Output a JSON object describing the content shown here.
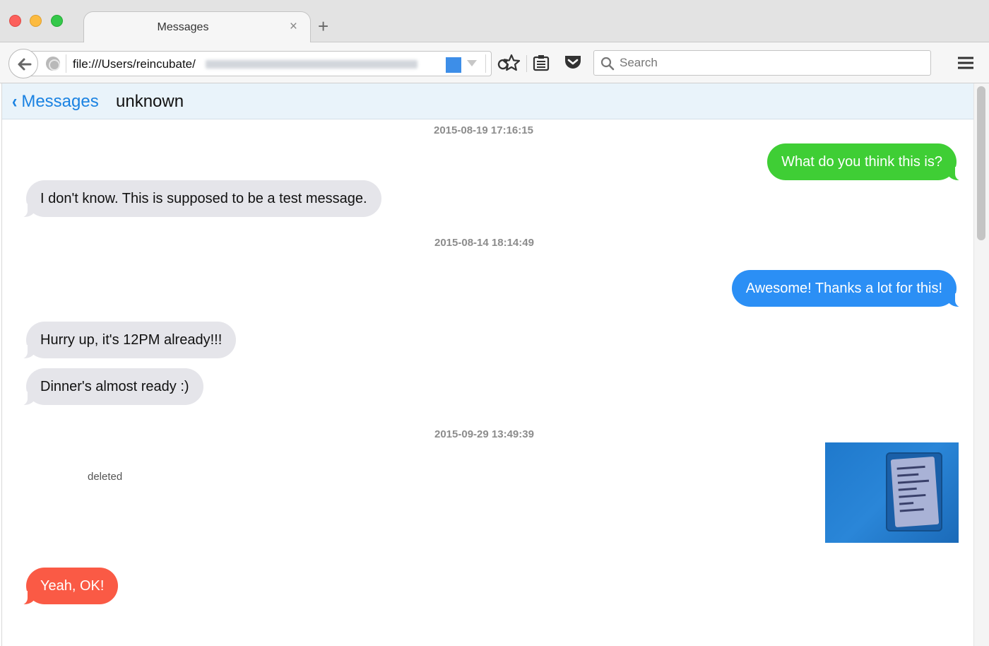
{
  "browser": {
    "tab_title": "Messages",
    "tab_close_icon": "×",
    "new_tab_icon": "+",
    "url": "file:///Users/reincubate/",
    "search_placeholder": "Search",
    "icons": [
      "back-arrow-icon",
      "globe-icon",
      "url-dropdown-icon",
      "reload-icon",
      "star-icon",
      "reading-list-icon",
      "pocket-icon",
      "search-icon",
      "hamburger-menu-icon"
    ]
  },
  "conversation": {
    "back_label": "Messages",
    "back_chevron": "‹",
    "title": "unknown"
  },
  "timeline": {
    "stamps": [
      "2015-08-19 17:16:15",
      "2015-08-14 18:14:49",
      "2015-09-29 13:49:39"
    ],
    "messages": [
      {
        "direction": "outgoing",
        "text": "What do you think this is?",
        "color": "#3fce35"
      },
      {
        "direction": "incoming",
        "text": "I don't know. This is supposed to be a test message.",
        "color": "#e5e5ea"
      },
      {
        "direction": "outgoing",
        "text": "Awesome! Thanks a lot for this!",
        "color": "#2b8ff5"
      },
      {
        "direction": "incoming",
        "text": "Hurry up, it's 12PM already!!!",
        "color": "#e5e5ea"
      },
      {
        "direction": "incoming",
        "text": "Dinner's almost ready :)",
        "color": "#e5e5ea"
      },
      {
        "direction": "outgoing",
        "type": "image"
      },
      {
        "direction": "incoming",
        "status": "deleted",
        "text": "Yeah, OK!",
        "color": "#fa5a45"
      }
    ]
  }
}
